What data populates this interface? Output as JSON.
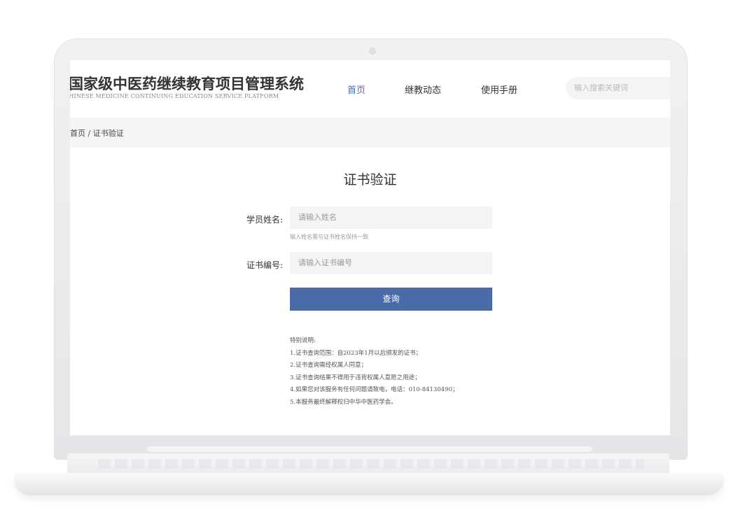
{
  "header": {
    "title": "国家级中医药继续教育项目管理系统",
    "subtitle": "CHINESE MEDICINE CONTINUING EDUCATION SERVICE PLATFORM",
    "nav": [
      {
        "label": "首页",
        "active": true
      },
      {
        "label": "继教动态",
        "active": false
      },
      {
        "label": "使用手册",
        "active": false
      }
    ],
    "search_placeholder": "输入搜索关键词"
  },
  "breadcrumb": "首页 / 证书验证",
  "form": {
    "title": "证书验证",
    "name_label": "学员姓名:",
    "name_placeholder": "请输入姓名",
    "name_hint": "输入姓名需与证书姓名保持一致",
    "cert_label": "证书编号:",
    "cert_placeholder": "请输入证书编号",
    "submit_label": "查询"
  },
  "notes": {
    "heading": "特别说明:",
    "items": [
      "1.证书查询范围：自2023年1月以后颁发的证书；",
      "2.证书查询需经权属人同意；",
      "3.证书查询结果不得用于违背权属人意愿之用途；",
      "4.如果您对该服务有任何问题请致电，电话：010-84130490；",
      "5.本服务最终解释权归中华中医药学会。"
    ]
  },
  "colors": {
    "accent": "#4a6aa8",
    "field_bg": "#f3f4f6",
    "breadcrumb_bg": "#f4f5f7"
  }
}
